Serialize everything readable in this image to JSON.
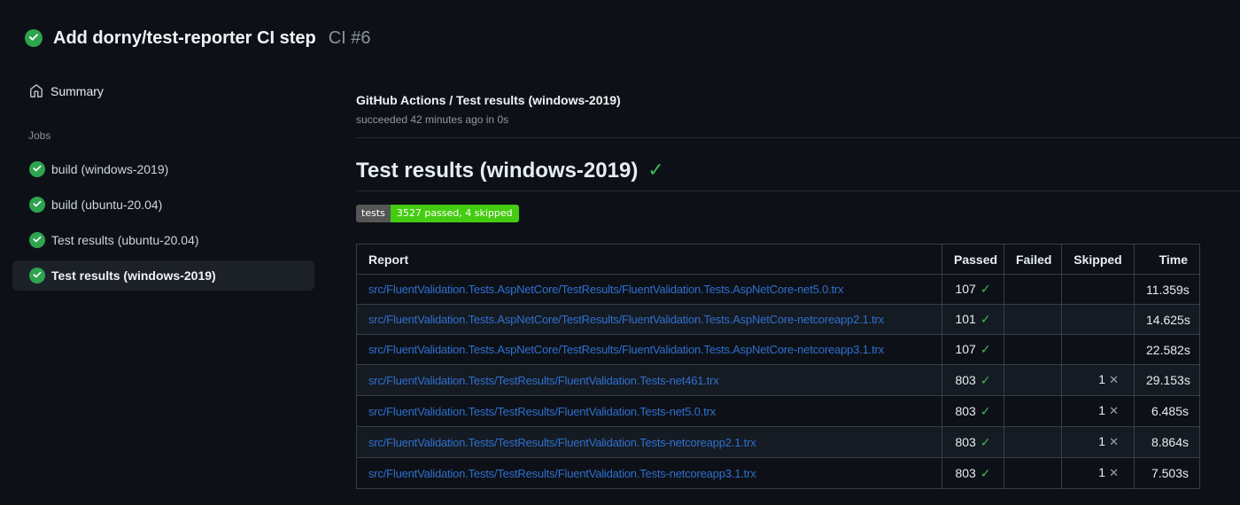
{
  "header": {
    "title": "Add dorny/test-reporter CI step",
    "run_number": "CI #6"
  },
  "sidebar": {
    "summary_label": "Summary",
    "jobs_section_label": "Jobs",
    "jobs": [
      {
        "label": "build (windows-2019)",
        "status": "success",
        "selected": false
      },
      {
        "label": "build (ubuntu-20.04)",
        "status": "success",
        "selected": false
      },
      {
        "label": "Test results (ubuntu-20.04)",
        "status": "success",
        "selected": false
      },
      {
        "label": "Test results (windows-2019)",
        "status": "success",
        "selected": true
      }
    ]
  },
  "main": {
    "check_title": "GitHub Actions / Test results (windows-2019)",
    "check_status": "succeeded 42 minutes ago in 0s",
    "heading": "Test results (windows-2019)",
    "badge": {
      "label": "tests",
      "value": "3527 passed, 4 skipped",
      "label_bg": "#555555",
      "value_bg": "#44cc11"
    },
    "table": {
      "headers": [
        "Report",
        "Passed",
        "Failed",
        "Skipped",
        "Time"
      ],
      "rows": [
        {
          "report": "src/FluentValidation.Tests.AspNetCore/TestResults/FluentValidation.Tests.AspNetCore-net5.0.trx",
          "passed": "107",
          "failed": "",
          "skipped": "",
          "time": "11.359s"
        },
        {
          "report": "src/FluentValidation.Tests.AspNetCore/TestResults/FluentValidation.Tests.AspNetCore-netcoreapp2.1.trx",
          "passed": "101",
          "failed": "",
          "skipped": "",
          "time": "14.625s"
        },
        {
          "report": "src/FluentValidation.Tests.AspNetCore/TestResults/FluentValidation.Tests.AspNetCore-netcoreapp3.1.trx",
          "passed": "107",
          "failed": "",
          "skipped": "",
          "time": "22.582s"
        },
        {
          "report": "src/FluentValidation.Tests/TestResults/FluentValidation.Tests-net461.trx",
          "passed": "803",
          "failed": "",
          "skipped": "1",
          "time": "29.153s"
        },
        {
          "report": "src/FluentValidation.Tests/TestResults/FluentValidation.Tests-net5.0.trx",
          "passed": "803",
          "failed": "",
          "skipped": "1",
          "time": "6.485s"
        },
        {
          "report": "src/FluentValidation.Tests/TestResults/FluentValidation.Tests-netcoreapp2.1.trx",
          "passed": "803",
          "failed": "",
          "skipped": "1",
          "time": "8.864s"
        },
        {
          "report": "src/FluentValidation.Tests/TestResults/FluentValidation.Tests-netcoreapp3.1.trx",
          "passed": "803",
          "failed": "",
          "skipped": "1",
          "time": "7.503s"
        }
      ]
    }
  },
  "icons": {
    "check": "✓",
    "cross": "✕",
    "status": "check-circle",
    "summary": "home"
  },
  "colors": {
    "background": "#0d1117",
    "success_green": "#2da44e",
    "check_green": "#3fb950",
    "link_blue": "#2f6fce",
    "muted_text": "#8b949e",
    "table_border": "#373e47",
    "row_stripe": "#151b23",
    "selected_item_bg": "#1c2128",
    "badge_label_bg": "#555555",
    "badge_value_bg": "#44cc11"
  }
}
